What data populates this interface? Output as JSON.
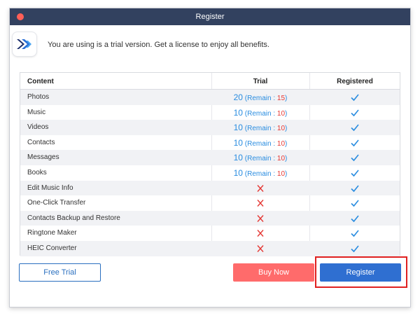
{
  "window": {
    "title": "Register"
  },
  "banner": {
    "message": "You are using is a trial version. Get a license to enjoy all benefits."
  },
  "table": {
    "headers": {
      "content": "Content",
      "trial": "Trial",
      "registered": "Registered"
    },
    "rows": [
      {
        "label": "Photos",
        "trial_type": "count",
        "trial_value": "20",
        "remain_label": "(Remain : ",
        "remain_value": "15",
        "remain_close": ")",
        "registered": "check"
      },
      {
        "label": "Music",
        "trial_type": "count",
        "trial_value": "10",
        "remain_label": "(Remain : ",
        "remain_value": "10",
        "remain_close": ")",
        "registered": "check"
      },
      {
        "label": "Videos",
        "trial_type": "count",
        "trial_value": "10",
        "remain_label": "(Remain : ",
        "remain_value": "10",
        "remain_close": ")",
        "registered": "check"
      },
      {
        "label": "Contacts",
        "trial_type": "count",
        "trial_value": "10",
        "remain_label": "(Remain : ",
        "remain_value": "10",
        "remain_close": ")",
        "registered": "check"
      },
      {
        "label": "Messages",
        "trial_type": "count",
        "trial_value": "10",
        "remain_label": "(Remain : ",
        "remain_value": "10",
        "remain_close": ")",
        "registered": "check"
      },
      {
        "label": "Books",
        "trial_type": "count",
        "trial_value": "10",
        "remain_label": "(Remain : ",
        "remain_value": "10",
        "remain_close": ")",
        "registered": "check"
      },
      {
        "label": "Edit Music Info",
        "trial_type": "unavailable",
        "registered": "check"
      },
      {
        "label": "One-Click Transfer",
        "trial_type": "unavailable",
        "registered": "check"
      },
      {
        "label": "Contacts Backup and Restore",
        "trial_type": "unavailable",
        "registered": "check"
      },
      {
        "label": "Ringtone Maker",
        "trial_type": "unavailable",
        "registered": "check"
      },
      {
        "label": "HEIC Converter",
        "trial_type": "unavailable",
        "registered": "check"
      }
    ]
  },
  "buttons": {
    "free_trial": "Free Trial",
    "buy_now": "Buy Now",
    "register": "Register"
  },
  "colors": {
    "titlebar": "#32415f",
    "accent_blue": "#2a8de0",
    "remain_red": "#e53935",
    "buy_button": "#ff6b6b",
    "register_button": "#2f6fd1",
    "highlight_box": "#e02020"
  },
  "icons": {
    "check": "checkmark-icon",
    "unavailable": "cross-icon",
    "app_logo": "app-logo-icon"
  }
}
